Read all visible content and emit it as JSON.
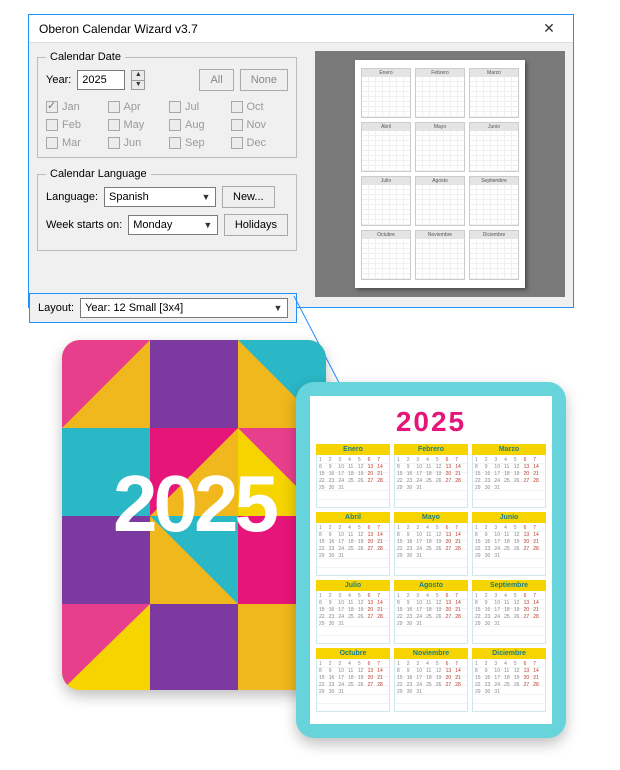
{
  "dialog": {
    "title": "Oberon Calendar Wizard v3.7",
    "close": "✕",
    "date_group": "Calendar Date",
    "year_label": "Year:",
    "year_value": "2025",
    "all": "All",
    "none": "None",
    "months": [
      "Jan",
      "Apr",
      "Jul",
      "Oct",
      "Feb",
      "May",
      "Aug",
      "Nov",
      "Mar",
      "Jun",
      "Sep",
      "Dec"
    ],
    "checked": [
      true,
      false,
      false,
      false,
      false,
      false,
      false,
      false,
      false,
      false,
      false,
      false
    ],
    "lang_group": "Calendar Language",
    "lang_label": "Language:",
    "lang_value": "Spanish",
    "new_btn": "New...",
    "week_label": "Week starts on:",
    "week_value": "Monday",
    "holidays": "Holidays",
    "layout_label": "Layout:",
    "layout_value": "Year: 12 Small [3x4]"
  },
  "preview": {
    "months": [
      "Enero",
      "Febrero",
      "Marzo",
      "Abril",
      "Mayo",
      "Junio",
      "Julio",
      "Agosto",
      "Septiembre",
      "Octubre",
      "Noviembre",
      "Diciembre"
    ]
  },
  "output": {
    "left_year": "2025",
    "right_year": "2025",
    "months": [
      "Enero",
      "Febrero",
      "Marzo",
      "Abril",
      "Mayo",
      "Junio",
      "Julio",
      "Agosto",
      "Septiembre",
      "Octubre",
      "Noviembre",
      "Diciembre"
    ],
    "colors": {
      "accent_pink": "#e6157a",
      "accent_yellow": "#f5d400",
      "accent_teal": "#67d4dc",
      "pattern": [
        "#f0b81c",
        "#e83f8d",
        "#2ab7c6",
        "#7c3aa0",
        "#f5d400",
        "#e6157a"
      ]
    }
  }
}
